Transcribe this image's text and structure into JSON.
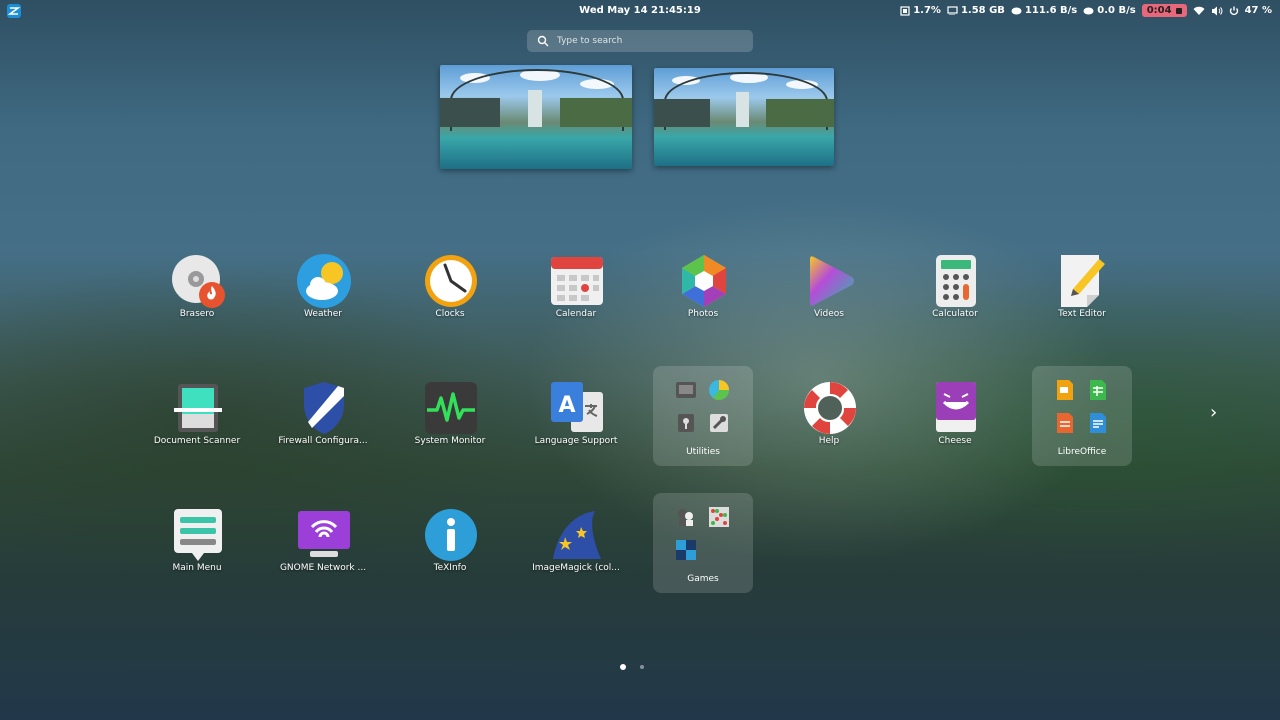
{
  "topbar": {
    "datetime": "Wed May 14  21:45:19",
    "cpu": "1.7%",
    "memory": "1.58 GB",
    "download": "111.6 B/s",
    "upload": "0.0 B/s",
    "recording": "0:04",
    "battery": "47 %"
  },
  "search": {
    "placeholder": "Type to search"
  },
  "apps": {
    "row1": [
      "Brasero",
      "Weather",
      "Clocks",
      "Calendar",
      "Photos",
      "Videos",
      "Calculator",
      "Text Editor"
    ],
    "row2": [
      "Document Scanner",
      "Firewall Configura...",
      "System Monitor",
      "Language Support",
      "Utilities",
      "Help",
      "Cheese",
      "LibreOffice"
    ],
    "row3": [
      "Main Menu",
      "GNOME Network ...",
      "TeXInfo",
      "ImageMagick (col...",
      "Games"
    ]
  },
  "colors": {
    "accent": "#e9677a"
  }
}
